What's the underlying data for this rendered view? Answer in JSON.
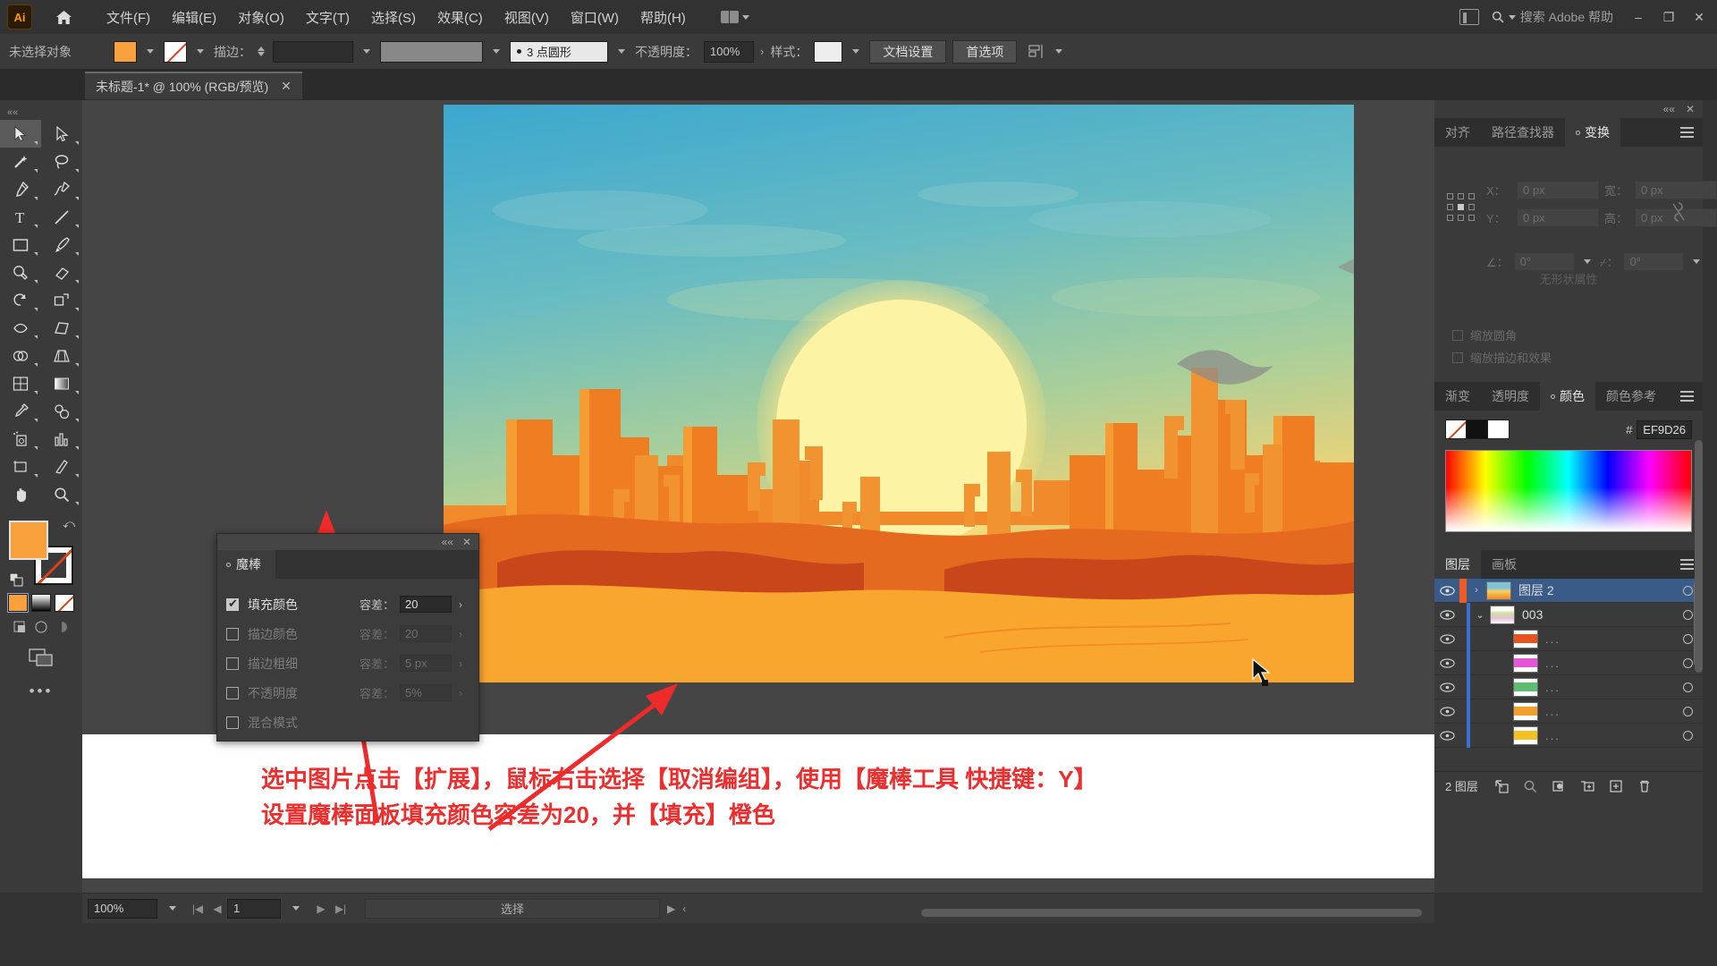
{
  "app": {
    "logo_text": "Ai",
    "home_icon": "home-icon",
    "workspace_icon": "workspace-switcher-icon"
  },
  "menubar": {
    "items": [
      {
        "label": "文件(F)"
      },
      {
        "label": "编辑(E)"
      },
      {
        "label": "对象(O)"
      },
      {
        "label": "文字(T)"
      },
      {
        "label": "选择(S)"
      },
      {
        "label": "效果(C)"
      },
      {
        "label": "视图(V)"
      },
      {
        "label": "窗口(W)"
      },
      {
        "label": "帮助(H)"
      }
    ],
    "search_placeholder": "搜索 Adobe 帮助",
    "minimize": "–",
    "restore": "❐",
    "close": "✕"
  },
  "controlbar": {
    "selection_status": "未选择对象",
    "fill_color": "#F8A13C",
    "stroke_label": "描边：",
    "stroke_weight": "",
    "brush_profile": "3 点圆形",
    "opacity_label": "不透明度：",
    "opacity_value": "100%",
    "style_label": "样式：",
    "doc_setup_button": "文档设置",
    "preferences_button": "首选项",
    "align_icon": "align-icon"
  },
  "document_tab": {
    "title": "未标题-1* @ 100% (RGB/预览)",
    "close": "✕"
  },
  "toolbar": {
    "tools": [
      {
        "name": "selection-tool",
        "selected": true
      },
      {
        "name": "direct-selection-tool",
        "selected": false
      },
      {
        "name": "magic-wand-tool",
        "selected": false
      },
      {
        "name": "lasso-tool",
        "selected": false
      },
      {
        "name": "pen-tool",
        "selected": false
      },
      {
        "name": "curvature-tool",
        "selected": false
      },
      {
        "name": "type-tool",
        "selected": false
      },
      {
        "name": "line-segment-tool",
        "selected": false
      },
      {
        "name": "rectangle-tool",
        "selected": false
      },
      {
        "name": "paintbrush-tool",
        "selected": false
      },
      {
        "name": "shaper-tool",
        "selected": false
      },
      {
        "name": "eraser-tool",
        "selected": false
      },
      {
        "name": "rotate-tool",
        "selected": false
      },
      {
        "name": "scale-tool",
        "selected": false
      },
      {
        "name": "width-tool",
        "selected": false
      },
      {
        "name": "free-transform-tool",
        "selected": false
      },
      {
        "name": "shape-builder-tool",
        "selected": false
      },
      {
        "name": "perspective-grid-tool",
        "selected": false
      },
      {
        "name": "mesh-tool",
        "selected": false
      },
      {
        "name": "gradient-tool",
        "selected": false
      },
      {
        "name": "eyedropper-tool",
        "selected": false
      },
      {
        "name": "blend-tool",
        "selected": false
      },
      {
        "name": "symbol-sprayer-tool",
        "selected": false
      },
      {
        "name": "column-graph-tool",
        "selected": false
      },
      {
        "name": "artboard-tool",
        "selected": false
      },
      {
        "name": "slice-tool",
        "selected": false
      },
      {
        "name": "hand-tool",
        "selected": false
      },
      {
        "name": "zoom-tool",
        "selected": false
      }
    ],
    "fill_swatch": "#F8A13C",
    "stroke_swatch": "none",
    "more_tools": "•••"
  },
  "magic_wand_panel": {
    "tab_label": "魔棒",
    "close": "✕",
    "collapse": "««",
    "rows": [
      {
        "label": "填充颜色",
        "checked": true,
        "tolerance_label": "容差：",
        "tolerance_value": "20",
        "enabled": true
      },
      {
        "label": "描边颜色",
        "checked": false,
        "tolerance_label": "容差：",
        "tolerance_value": "20",
        "enabled": false
      },
      {
        "label": "描边粗细",
        "checked": false,
        "tolerance_label": "容差：",
        "tolerance_value": "5 px",
        "enabled": false
      },
      {
        "label": "不透明度",
        "checked": false,
        "tolerance_label": "容差：",
        "tolerance_value": "5%",
        "enabled": false
      },
      {
        "label": "混合模式",
        "checked": false,
        "tolerance_label": "",
        "tolerance_value": "",
        "enabled": false
      }
    ]
  },
  "transform_panel": {
    "tabs": [
      {
        "label": "对齐",
        "active": false
      },
      {
        "label": "路径查找器",
        "active": false
      },
      {
        "label": "变换",
        "active": true
      }
    ],
    "menu_icon": "panel-menu-icon",
    "close": "✕",
    "collapse": "««",
    "fields": [
      {
        "label": "X：",
        "value": "0 px"
      },
      {
        "label": "宽：",
        "value": "0 px"
      },
      {
        "label": "Y：",
        "value": "0 px"
      },
      {
        "label": "高：",
        "value": "0 px"
      }
    ],
    "angle_label": "∠：",
    "angle_value": "0°",
    "shear_label": "⌿：",
    "shear_value": "0°",
    "checkbox_scale_corners": "缩放圆角",
    "checkbox_scale_strokes": "缩放描边和效果",
    "no_attributes": "无形状属性",
    "link_icon": "link-broken-icon"
  },
  "color_panel": {
    "tabs": [
      {
        "label": "渐变",
        "active": false
      },
      {
        "label": "透明度",
        "active": false
      },
      {
        "label": "颜色",
        "active": true
      },
      {
        "label": "颜色参考",
        "active": false
      }
    ],
    "menu_icon": "panel-menu-icon",
    "hex_prefix": "#",
    "hex_value": "EF9D26",
    "spectrum_icon": "color-spectrum"
  },
  "layers_panel": {
    "tabs": [
      {
        "label": "图层",
        "active": true
      },
      {
        "label": "画板",
        "active": false
      }
    ],
    "menu_icon": "panel-menu-icon",
    "rows": [
      {
        "name": "图层 2",
        "selected": true,
        "indent": 0,
        "thumb_type": "artwork",
        "has_disclosure": true,
        "disclosure": "›",
        "color": "#f05a28"
      },
      {
        "name": "003",
        "selected": false,
        "indent": 1,
        "thumb_type": "group",
        "has_disclosure": true,
        "disclosure": "⌄",
        "color": "#3b6fd4"
      },
      {
        "name": "...",
        "selected": false,
        "indent": 2,
        "thumb_type": "path",
        "has_disclosure": false,
        "disclosure": "",
        "color": "#3b6fd4",
        "swatch": "#e8531d"
      },
      {
        "name": "...",
        "selected": false,
        "indent": 2,
        "thumb_type": "path",
        "has_disclosure": false,
        "disclosure": "",
        "color": "#3b6fd4",
        "swatch": "#e456d6"
      },
      {
        "name": "...",
        "selected": false,
        "indent": 2,
        "thumb_type": "path",
        "has_disclosure": false,
        "disclosure": "",
        "color": "#3b6fd4",
        "swatch": "#5bbd6d"
      },
      {
        "name": "...",
        "selected": false,
        "indent": 2,
        "thumb_type": "path",
        "has_disclosure": false,
        "disclosure": "",
        "color": "#3b6fd4",
        "swatch": "#f0a02a"
      },
      {
        "name": "...",
        "selected": false,
        "indent": 2,
        "thumb_type": "path",
        "has_disclosure": false,
        "disclosure": "",
        "color": "#3b6fd4",
        "swatch": "#f2c224"
      }
    ],
    "footer_count": "2 图层",
    "footer_icons": [
      {
        "name": "locate-object-icon"
      },
      {
        "name": "search-layer-icon"
      },
      {
        "name": "make-mask-icon"
      },
      {
        "name": "new-sublayer-icon"
      },
      {
        "name": "new-layer-icon"
      },
      {
        "name": "delete-layer-icon"
      }
    ]
  },
  "statusbar": {
    "zoom_value": "100%",
    "page_value": "1",
    "status_text": "选择",
    "first_icon": "first-page-icon",
    "prev_icon": "prev-page-icon",
    "next_icon": "next-page-icon",
    "last_icon": "last-page-icon"
  },
  "annotation": {
    "line1": "选中图片点击【扩展】，鼠标右击选择【取消编组】，使用【魔棒工具 快捷键：Y】",
    "line2": "设置魔棒面板填充颜色容差为20，并【填充】橙色",
    "color": "#EC2E2E"
  },
  "artwork": {
    "description": "desert-sunset-illustration",
    "sky_top": "#4aa8c8",
    "sky_mid": "#9fc9a8",
    "sun": "#fdf3a8",
    "sand": "#f7a02e",
    "rock_dark": "#d4511a",
    "rock_mid": "#ef7d22"
  }
}
